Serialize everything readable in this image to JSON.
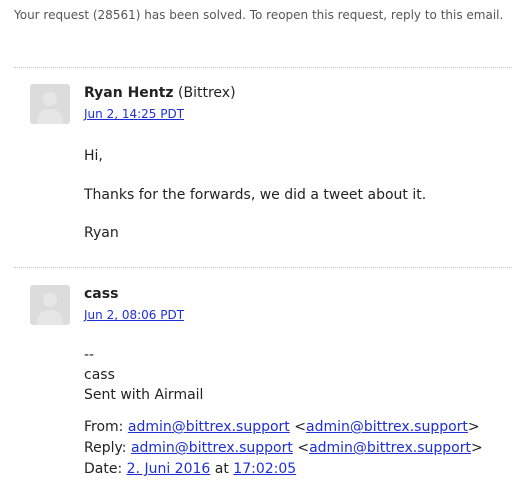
{
  "status": {
    "text": "Your request (28561) has been solved. To reopen this request, reply to this email."
  },
  "messages": [
    {
      "author_name": "Ryan Hentz",
      "author_org": "(Bittrex)",
      "timestamp": "Jun 2, 14:25 PDT",
      "lines": [
        "Hi,",
        "Thanks for the forwards, we did a tweet about it.",
        "Ryan"
      ]
    },
    {
      "author_name": "cass",
      "author_org": "",
      "timestamp": "Jun 2, 08:06 PDT",
      "signature": [
        "--",
        "cass",
        "Sent with Airmail"
      ],
      "forward": {
        "from_label": "From:",
        "from_email": "admin@bittrex.support",
        "from_email_angle": "admin@bittrex.support",
        "reply_label": "Reply:",
        "reply_email": "admin@bittrex.support",
        "reply_email_angle": "admin@bittrex.support",
        "date_label": "Date:",
        "date_value": "2. Juni 2016",
        "at_label": "at",
        "time_value": "17:02:05"
      }
    }
  ],
  "colors": {
    "link": "#1f2fd8",
    "divider": "#c8c8c8",
    "avatar": "#dcdcdc"
  },
  "icons": {
    "avatar": "user-silhouette-icon"
  }
}
